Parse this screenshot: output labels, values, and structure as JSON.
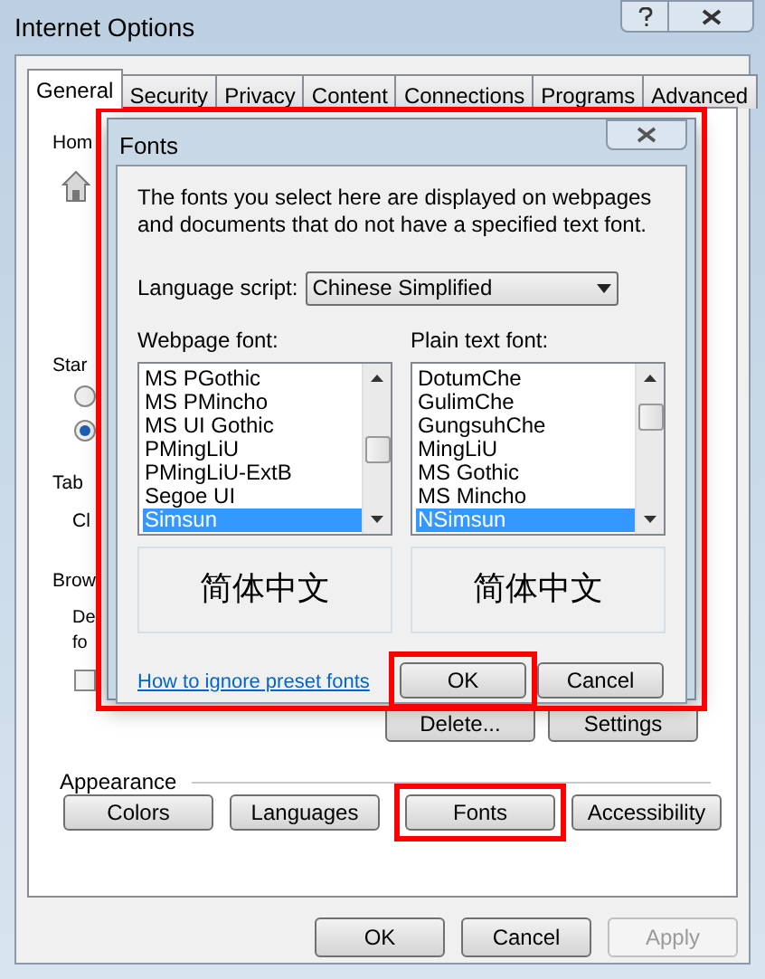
{
  "window": {
    "title": "Internet Options"
  },
  "tabs": [
    {
      "label": "General",
      "selected": true
    },
    {
      "label": "Security",
      "selected": false
    },
    {
      "label": "Privacy",
      "selected": false
    },
    {
      "label": "Content",
      "selected": false
    },
    {
      "label": "Connections",
      "selected": false
    },
    {
      "label": "Programs",
      "selected": false
    },
    {
      "label": "Advanced",
      "selected": false
    }
  ],
  "general": {
    "home_label": "Hom",
    "startup_label": "Star",
    "startup_options": [
      {
        "selected": false
      },
      {
        "selected": true
      }
    ],
    "tabs_label": "Tab",
    "tabs_line": "Cl",
    "browsing_label": "Brow",
    "browsing_lines": [
      "De",
      "fo"
    ],
    "browsing_checkbox": {
      "checked": false
    },
    "browsing_buttons": [
      "Delete...",
      "Settings"
    ]
  },
  "appearance": {
    "label": "Appearance",
    "buttons": [
      {
        "label": "Colors",
        "highlighted": false
      },
      {
        "label": "Languages",
        "highlighted": false
      },
      {
        "label": "Fonts",
        "highlighted": true
      },
      {
        "label": "Accessibility",
        "highlighted": false
      }
    ]
  },
  "footer_buttons": [
    {
      "label": "OK",
      "disabled": false
    },
    {
      "label": "Cancel",
      "disabled": false
    },
    {
      "label": "Apply",
      "disabled": true
    }
  ],
  "fonts_dialog": {
    "title": "Fonts",
    "highlighted": true,
    "description": "The fonts you select here are displayed on webpages and documents that do not have a specified text font.",
    "language_label": "Language script:",
    "language_value": "Chinese Simplified",
    "webpage_font": {
      "label": "Webpage font:",
      "items": [
        {
          "text": "MS PGothic",
          "selected": false
        },
        {
          "text": "MS PMincho",
          "selected": false
        },
        {
          "text": "MS UI Gothic",
          "selected": false
        },
        {
          "text": "PMingLiU",
          "selected": false
        },
        {
          "text": "PMingLiU-ExtB",
          "selected": false
        },
        {
          "text": "Segoe UI",
          "selected": false
        },
        {
          "text": "Simsun",
          "selected": true
        }
      ],
      "preview": "简体中文"
    },
    "plain_font": {
      "label": "Plain text font:",
      "items": [
        {
          "text": "DotumChe",
          "selected": false
        },
        {
          "text": "GulimChe",
          "selected": false
        },
        {
          "text": "GungsuhChe",
          "selected": false
        },
        {
          "text": "MingLiU",
          "selected": false
        },
        {
          "text": "MS Gothic",
          "selected": false
        },
        {
          "text": "MS Mincho",
          "selected": false
        },
        {
          "text": "NSimsun",
          "selected": true
        }
      ],
      "preview": "简体中文"
    },
    "link": "How to ignore preset fonts",
    "buttons": [
      {
        "label": "OK",
        "highlighted": true
      },
      {
        "label": "Cancel",
        "highlighted": false
      }
    ]
  }
}
